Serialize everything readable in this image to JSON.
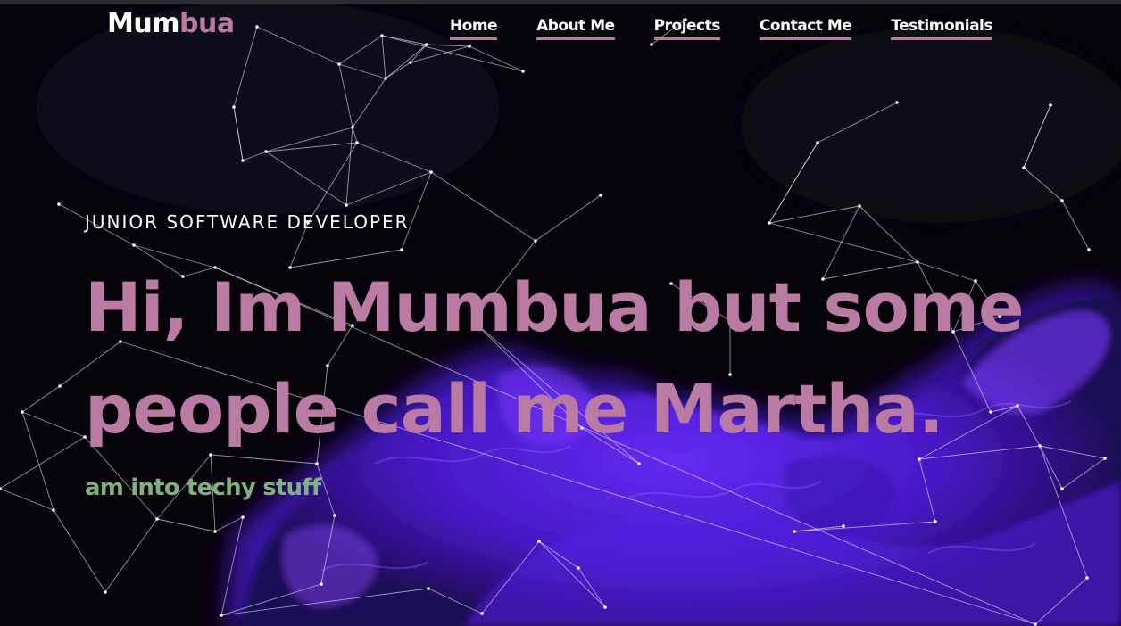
{
  "brand": {
    "name_part1": "Mum",
    "name_part2": "bua"
  },
  "nav": {
    "items": [
      {
        "label": "Home"
      },
      {
        "label": "About Me"
      },
      {
        "label": "Projects"
      },
      {
        "label": "Contact Me"
      },
      {
        "label": "Testimonials"
      }
    ]
  },
  "hero": {
    "subtitle": "JUNIOR SOFTWARE DEVELOPER",
    "headline_line1": "Hi, Im Mumbua but some",
    "headline_line2": "people call me Martha.",
    "tagline": "am into techy stuff"
  },
  "colors": {
    "accent_pink": "#b97aa3",
    "tagline_green": "#7fb17e",
    "background": "#060309",
    "smoke_purple": "#4d1ad8"
  }
}
